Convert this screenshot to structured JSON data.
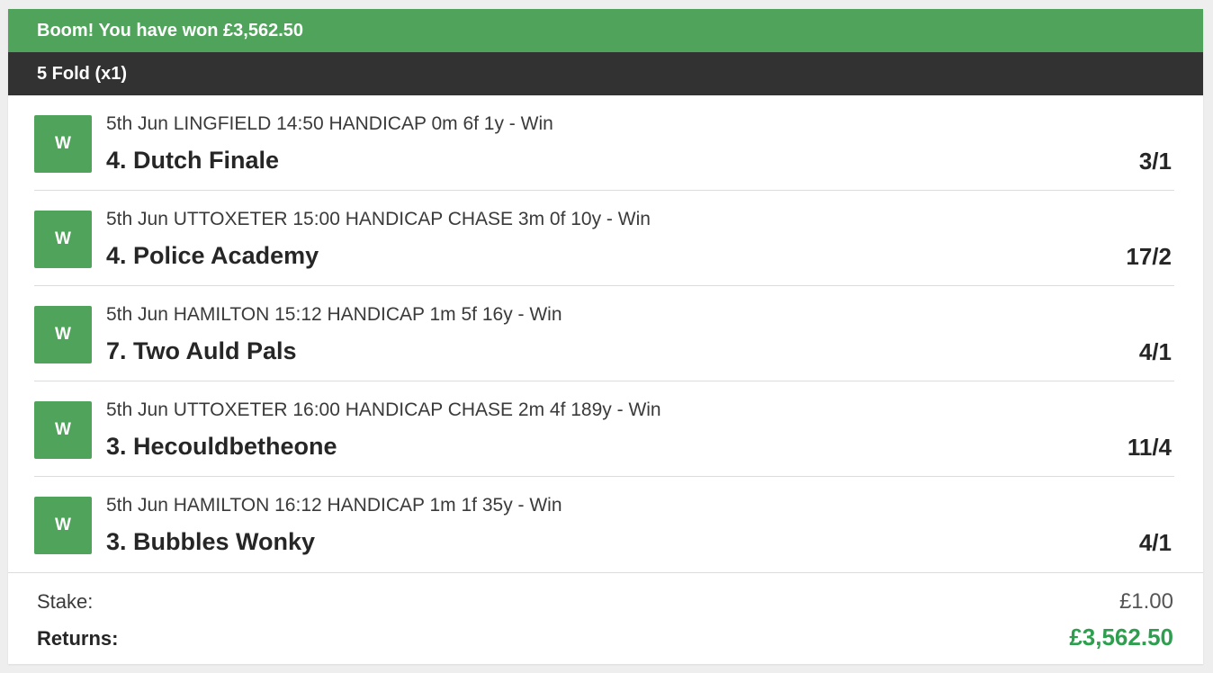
{
  "banner": {
    "text": "Boom! You have won £3,562.50"
  },
  "bet": {
    "type": "5 Fold (x1)"
  },
  "colors": {
    "accent_green": "#4fa35a",
    "header_dark": "#323232",
    "returns_green": "#2e9e4f"
  },
  "selections": [
    {
      "result": "W",
      "event": "5th Jun LINGFIELD 14:50 HANDICAP 0m 6f 1y - Win",
      "runner": "4. Dutch Finale",
      "odds": "3/1"
    },
    {
      "result": "W",
      "event": "5th Jun UTTOXETER 15:00 HANDICAP CHASE 3m 0f 10y - Win",
      "runner": "4. Police Academy",
      "odds": "17/2"
    },
    {
      "result": "W",
      "event": "5th Jun HAMILTON 15:12 HANDICAP 1m 5f 16y - Win",
      "runner": "7. Two Auld Pals",
      "odds": "4/1"
    },
    {
      "result": "W",
      "event": "5th Jun UTTOXETER 16:00 HANDICAP CHASE 2m 4f 189y - Win",
      "runner": "3. Hecouldbetheone",
      "odds": "11/4"
    },
    {
      "result": "W",
      "event": "5th Jun HAMILTON 16:12 HANDICAP 1m 1f 35y - Win",
      "runner": "3. Bubbles Wonky",
      "odds": "4/1"
    }
  ],
  "summary": {
    "stake_label": "Stake:",
    "stake_value": "£1.00",
    "returns_label": "Returns:",
    "returns_value": "£3,562.50"
  }
}
